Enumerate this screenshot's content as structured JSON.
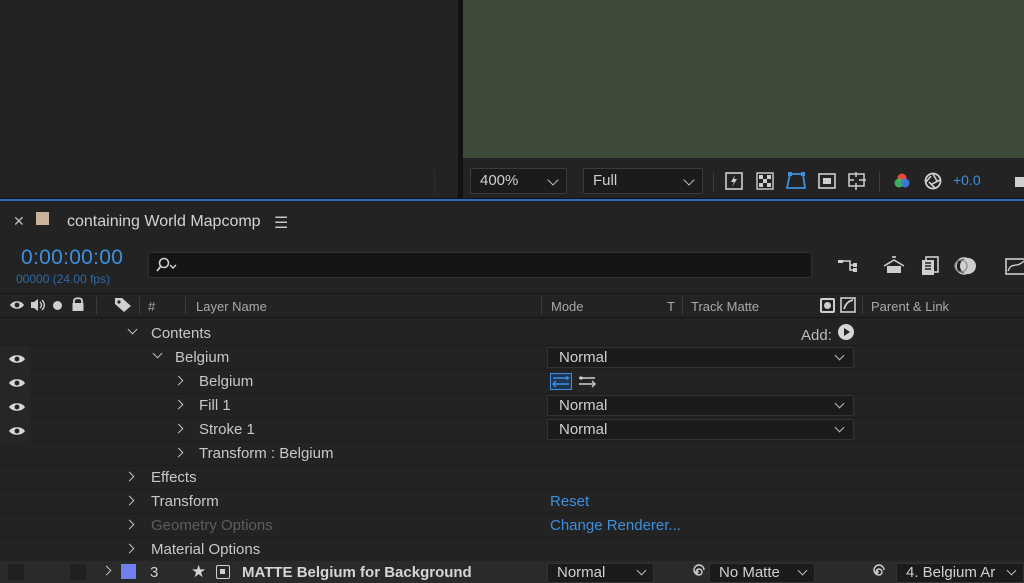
{
  "viewer": {
    "zoom": "400%",
    "resolution": "Full",
    "exposure": "+0.0"
  },
  "comp": {
    "tab_title": "containing World Mapcomp",
    "timecode": "0:00:00:00",
    "frame_info": "00000 (24.00 fps)",
    "search_placeholder": ""
  },
  "columns": {
    "number": "#",
    "layer_name": "Layer Name",
    "mode": "Mode",
    "t": "T",
    "track_matte": "Track Matte",
    "parent_link": "Parent & Link"
  },
  "rows": [
    {
      "label": "Contents",
      "add_label": "Add:"
    },
    {
      "label": "Belgium",
      "mode": "Normal"
    },
    {
      "label": "Belgium"
    },
    {
      "label": "Fill 1",
      "mode": "Normal"
    },
    {
      "label": "Stroke 1",
      "mode": "Normal"
    },
    {
      "label": "Transform : Belgium"
    },
    {
      "label": "Effects"
    },
    {
      "label": "Transform",
      "link": "Reset"
    },
    {
      "label": "Geometry Options",
      "link": "Change Renderer..."
    },
    {
      "label": "Material Options"
    }
  ],
  "layer": {
    "number": "3",
    "name": "MATTE Belgium for Background",
    "mode": "Normal",
    "track_matte": "No Matte",
    "parent": "4. Belgium Ar",
    "label_color": "#6f7ff0"
  },
  "colors": {
    "accent": "#3d8fe0",
    "viewer_bg": "#3e4b39",
    "panel_bg": "#232323"
  }
}
